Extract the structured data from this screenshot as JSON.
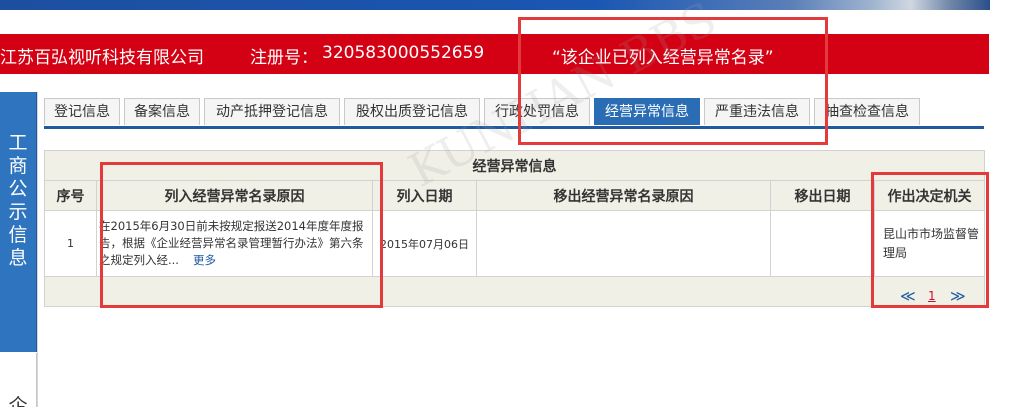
{
  "header": {
    "company_name": "江苏百弘视听科技有限公司",
    "reg_label": "注册号：",
    "reg_number": "320583000552659",
    "notice": "“该企业已列入经营异常名录”"
  },
  "side_nav": {
    "primary_label": "工商公示信息",
    "secondary_label_partial": "企"
  },
  "tabs": [
    {
      "label": "登记信息",
      "active": false
    },
    {
      "label": "备案信息",
      "active": false
    },
    {
      "label": "动产抵押登记信息",
      "active": false
    },
    {
      "label": "股权出质登记信息",
      "active": false
    },
    {
      "label": "行政处罚信息",
      "active": false
    },
    {
      "label": "经营异常信息",
      "active": true
    },
    {
      "label": "严重违法信息",
      "active": false
    },
    {
      "label": "抽查检查信息",
      "active": false
    }
  ],
  "table": {
    "caption": "经营异常信息",
    "columns": [
      "序号",
      "列入经营异常名录原因",
      "列入日期",
      "移出经营异常名录原因",
      "移出日期",
      "作出决定机关"
    ],
    "rows": [
      {
        "seq": "1",
        "reason": "在2015年6月30日前未按规定报送2014年度年度报告，根据《企业经营异常名录管理暂行办法》第六条之规定列入经...",
        "more_label": "更多",
        "list_date": "2015年07月06日",
        "removal_reason": "",
        "removal_date": "",
        "authority": "昆山市市场监督管理局"
      }
    ]
  },
  "pager": {
    "prev": "≪",
    "current": "1",
    "next": "≫"
  },
  "colors": {
    "header_red": "#d40013",
    "active_tab_blue": "#2b6db5",
    "side_nav_blue": "#2e74bf",
    "annotation_red": "#e33b3b"
  },
  "watermark_text": "KUNHAN BBS"
}
